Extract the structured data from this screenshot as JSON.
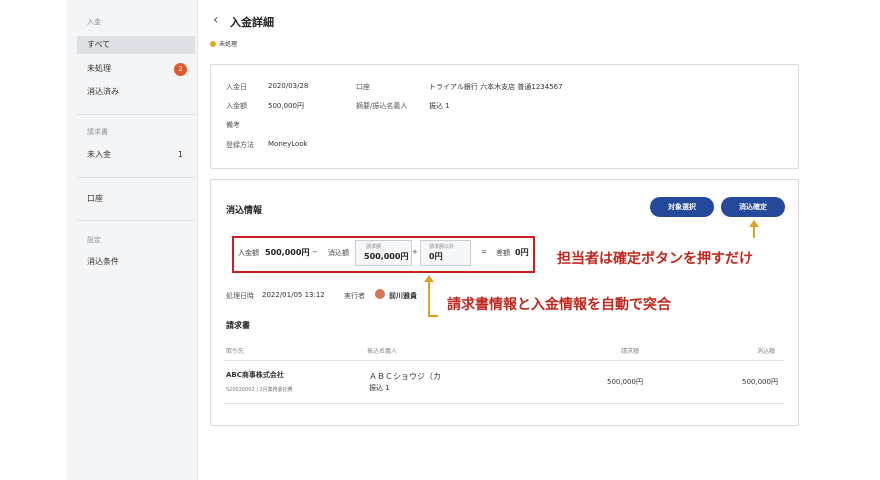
{
  "sidebar": {
    "section_deposit": "入金",
    "items": [
      {
        "label": "すべて"
      },
      {
        "label": "未処理",
        "badge": "2"
      },
      {
        "label": "消込済み"
      }
    ],
    "section_invoice": "請求書",
    "invoice_items": [
      {
        "label": "未入金",
        "count": "1"
      }
    ],
    "account": "口座",
    "section_settings": "設定",
    "settings_items": [
      {
        "label": "消込条件"
      }
    ]
  },
  "header": {
    "title": "入金詳細",
    "status": "未処理"
  },
  "detail": {
    "date_label": "入金日",
    "date_value": "2020/03/28",
    "amount_label": "入金額",
    "amount_value": "500,000円",
    "note_label": "備考",
    "method_label": "登録方法",
    "method_value": "MoneyLook",
    "account_label": "口座",
    "account_value": "トライアル銀行 六本木支店 普通1234567",
    "payer_label": "摘要/振込名義人",
    "payer_value": "振込 1"
  },
  "reconcile": {
    "title": "消込情報",
    "select_button": "対象選択",
    "confirm_button": "消込確定",
    "calc": {
      "deposit_label": "入金額",
      "deposit_value": "500,000円",
      "minus": "−",
      "recon_label": "消込額",
      "invoice_sub_label": "請求額",
      "invoice_sub_value": "500,000円",
      "plus": "+",
      "other_sub_label": "請求額以外",
      "other_sub_value": "0円",
      "equals": "=",
      "diff_label": "差額",
      "diff_value": "0円"
    },
    "processed_label": "処理日時",
    "processed_value": "2022/01/05 13:12",
    "executor_label": "実行者",
    "executor_value": "前川雅貴",
    "invoice_title": "請求書",
    "table": {
      "headers": [
        "取引先",
        "振込名義人",
        "請求額",
        "消込額"
      ],
      "row": {
        "client": "ABC商事株式会社",
        "client_sub": "S20020002 | 2月業務委託費",
        "payer": "ＡＢＣショウジ（カ",
        "payer_sub": "振込 1",
        "invoice_amount": "500,000円",
        "recon_amount": "500,000円"
      }
    }
  },
  "annotations": {
    "confirm_note": "担当者は確定ボタンを押すだけ",
    "match_note": "請求書情報と入金情報を自動で突合"
  },
  "colors": {
    "primary_button": "#24489a",
    "annotation_red": "#c0281e",
    "arrow": "#e0a020",
    "badge": "#e05a2b",
    "status_dot": "#e3a820"
  }
}
